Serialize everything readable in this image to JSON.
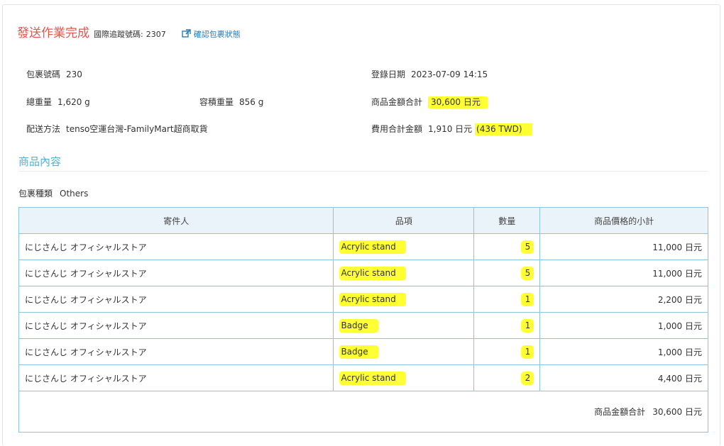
{
  "header": {
    "title": "發送作業完成",
    "tracking_label": "國際追蹤號碼:",
    "tracking_value": "2307",
    "status_link": "確認包裹狀態"
  },
  "summary": {
    "package_no_label": "包裹號碼",
    "package_no_value": "230",
    "register_date_label": "登錄日期",
    "register_date_value": "2023-07-09 14:15",
    "gross_weight_label": "總重量",
    "gross_weight_value": "1,620 g",
    "volume_weight_label": "容積重量",
    "volume_weight_value": "856 g",
    "goods_total_label": "商品金額合計",
    "goods_total_value": "30,600 日元",
    "shipping_label": "配送方法",
    "shipping_value": "tenso空運台灣-FamilyMart超商取貨",
    "fee_total_label": "費用合計金額",
    "fee_total_value": "1,910 日元",
    "fee_total_twd": "(436 TWD)"
  },
  "contents": {
    "section_title": "商品內容",
    "package_type_label": "包裹種類",
    "package_type_value": "Others",
    "columns": [
      "寄件人",
      "品項",
      "數量",
      "商品價格的小計"
    ],
    "rows": [
      {
        "sender": "にじさんじ オフィシャルストア",
        "item": "Acrylic stand",
        "qty": "5",
        "subtotal": "11,000 日元"
      },
      {
        "sender": "にじさんじ オフィシャルストア",
        "item": "Acrylic stand",
        "qty": "5",
        "subtotal": "11,000 日元"
      },
      {
        "sender": "にじさんじ オフィシャルストア",
        "item": "Acrylic stand",
        "qty": "1",
        "subtotal": "2,200 日元"
      },
      {
        "sender": "にじさんじ オフィシャルストア",
        "item": "Badge",
        "qty": "1",
        "subtotal": "1,000 日元"
      },
      {
        "sender": "にじさんじ オフィシャルストア",
        "item": "Badge",
        "qty": "1",
        "subtotal": "1,000 日元"
      },
      {
        "sender": "にじさんじ オフィシャルストア",
        "item": "Acrylic stand",
        "qty": "2",
        "subtotal": "4,400 日元"
      }
    ],
    "total_label": "商品金額合計",
    "total_value": "30,600 日元"
  },
  "colors": {
    "title_red": "#e2574c",
    "link_blue": "#2a7bb8",
    "section_blue": "#5aaecc",
    "table_border": "#8cc5de",
    "table_header_bg": "#eaf3fa",
    "highlight_yellow": "#ffff33"
  },
  "icons": {
    "status_link_icon": "external-link-icon"
  }
}
